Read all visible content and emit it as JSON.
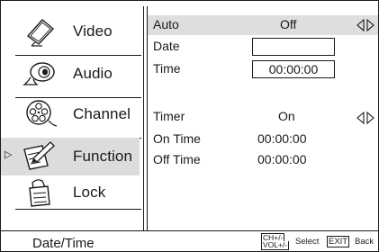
{
  "menu": [
    {
      "label": "Video",
      "icon": "video-display-icon"
    },
    {
      "label": "Audio",
      "icon": "speaker-icon"
    },
    {
      "label": "Channel",
      "icon": "film-reel-icon"
    },
    {
      "label": "Function",
      "icon": "pencil-paper-icon",
      "selected": true,
      "indicator": "▷"
    },
    {
      "label": "Lock",
      "icon": "lock-icon"
    }
  ],
  "settings": {
    "auto_label": "Auto",
    "auto_value": "Off",
    "date_label": "Date",
    "date_value": "",
    "time_label": "Time",
    "time_value": "00:00:00",
    "timer_label": "Timer",
    "timer_value": "On",
    "on_time_label": "On Time",
    "on_time_value": "00:00:00",
    "off_time_label": "Off Time",
    "off_time_value": "00:00:00"
  },
  "status": {
    "title": "Date/Time"
  },
  "hints": {
    "ch_key": "CH+/-",
    "vol_key": "VOL+/-",
    "select_label": "Select",
    "exit_key": "EXIT",
    "back_label": "Back"
  },
  "colors": {
    "highlight": "#dcdcdc",
    "line": "#1a1a1a",
    "background": "#ffffff"
  }
}
